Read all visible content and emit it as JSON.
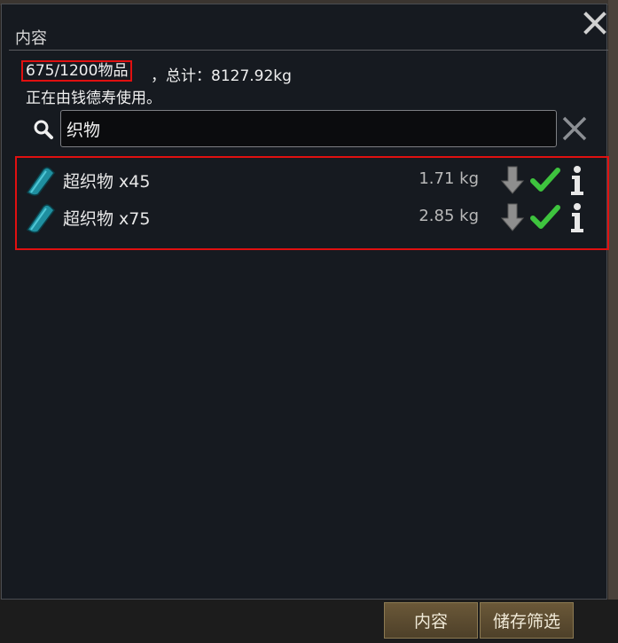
{
  "window": {
    "tab_title": "内容",
    "capacity": "675/1200物品",
    "total": "，总计：8127.92kg",
    "usage": "正在由钱德寿使用。"
  },
  "search": {
    "value": "织物"
  },
  "items": [
    {
      "label": "超织物 x45",
      "weight": "1.71 kg"
    },
    {
      "label": "超织物 x75",
      "weight": "2.85 kg"
    }
  ],
  "bottom_buttons": {
    "contents": "内容",
    "storage_filter": "储存筛选"
  },
  "icons": {
    "close": "close-icon",
    "search": "search-icon",
    "clear": "clear-icon",
    "item": "hyperweave-icon",
    "drop": "drop-arrow-icon",
    "check": "check-icon",
    "info": "info-icon"
  },
  "colors": {
    "highlight": "#e01010",
    "check": "#3ec43e",
    "button": "#5c4b30"
  }
}
